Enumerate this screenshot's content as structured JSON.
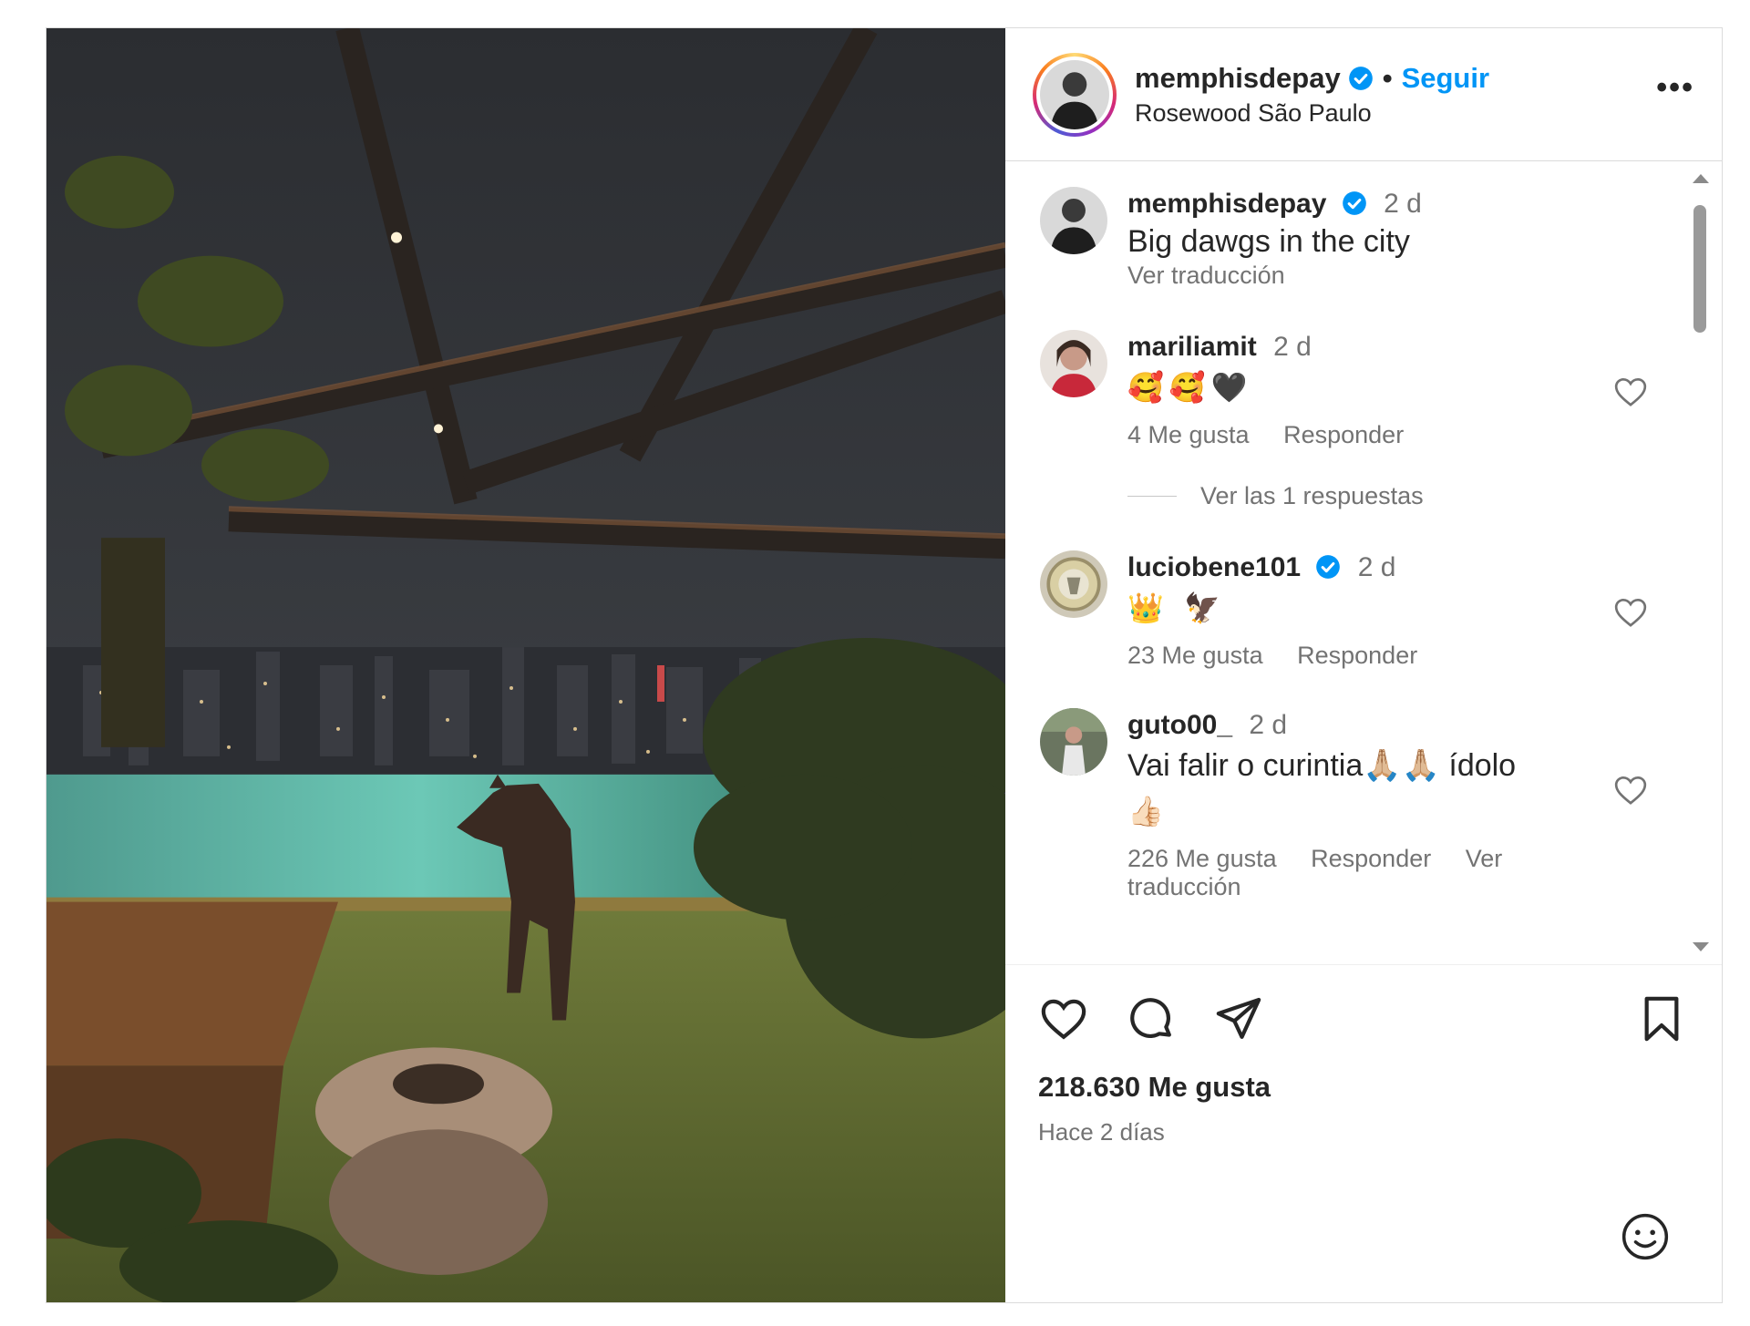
{
  "post": {
    "author": {
      "username": "memphisdepay",
      "verified": true,
      "follow_label": "Seguir",
      "separator": "•",
      "location": "Rosewood São Paulo"
    },
    "more_icon": "more-options-icon",
    "more_label": "•••"
  },
  "caption": {
    "username": "memphisdepay",
    "time": "2 d",
    "text": "Big dawgs in the city",
    "translate_label": "Ver traducción"
  },
  "comments": [
    {
      "username": "mariliamit",
      "verified": false,
      "time": "2 d",
      "text": "🥰🥰🖤",
      "likes": "4 Me gusta",
      "reply_label": "Responder",
      "view_replies": "Ver las 1 respuestas"
    },
    {
      "username": "luciobene101",
      "verified": true,
      "time": "2 d",
      "text": "👑 🦅",
      "likes": "23 Me gusta",
      "reply_label": "Responder"
    },
    {
      "username": "guto00_",
      "verified": false,
      "time": "2 d",
      "text": "Vai falir o curintia🙏🏼🙏🏼 ídolo",
      "text_line2": "👍🏻",
      "likes": "226 Me gusta",
      "reply_label": "Responder",
      "translate_label": "Ver traducción"
    }
  ],
  "footer": {
    "likes": "218.630 Me gusta",
    "posted": "Hace 2 días"
  },
  "colors": {
    "link": "#0095f6",
    "verified": "#0095f6",
    "muted": "#737373",
    "text": "#262626",
    "border": "#dbdbdb"
  }
}
